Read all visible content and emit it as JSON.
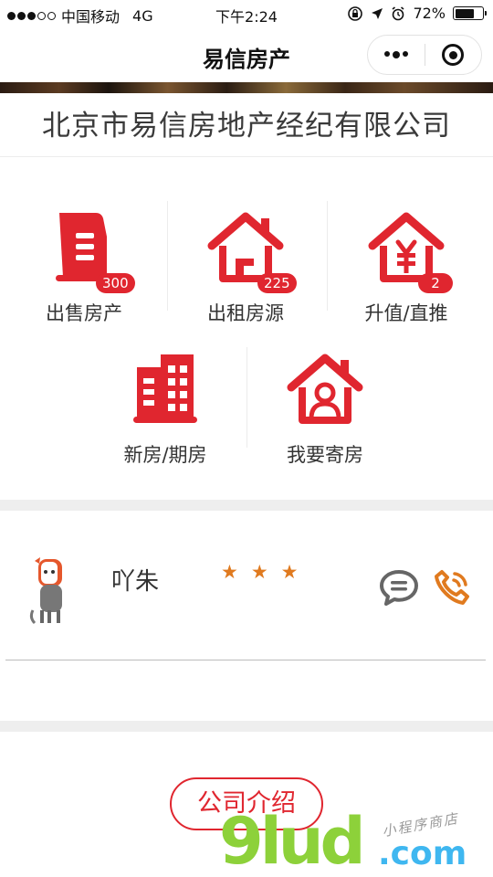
{
  "status_bar": {
    "carrier": "中国移动",
    "network": "4G",
    "time": "下午2:24",
    "battery": "72%",
    "battery_level": 0.72
  },
  "nav": {
    "title": "易信房产"
  },
  "company": {
    "name": "北京市易信房地产经纪有限公司"
  },
  "menu": [
    {
      "label": "出售房产",
      "badge": "300",
      "icon": "building-doc-icon"
    },
    {
      "label": "出租房源",
      "badge": "225",
      "icon": "house-icon"
    },
    {
      "label": "升值/直推",
      "badge": "2",
      "icon": "yuan-house-icon"
    },
    {
      "label": "新房/期房",
      "badge": "",
      "icon": "apartment-icon"
    },
    {
      "label": "我要寄房",
      "badge": "",
      "icon": "person-house-icon"
    }
  ],
  "agent": {
    "name": "吖朱",
    "rating": 3,
    "stars": "★ ★ ★"
  },
  "intro_button": "公司介绍",
  "watermark": {
    "brand": "9lud",
    "suffix": ".com",
    "tagline": "小程序商店"
  },
  "colors": {
    "accent": "#e0262f",
    "star": "#e07a1f",
    "phone": "#e07a1f",
    "chat": "#666666"
  }
}
